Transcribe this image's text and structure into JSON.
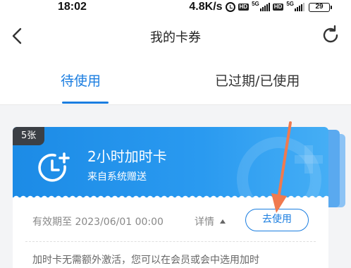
{
  "status_bar": {
    "time": "18:02",
    "speed": "4.8K/s",
    "hd_badge": "HD",
    "network_1": "5G",
    "network_2": "5G",
    "battery": "29"
  },
  "header": {
    "title": "我的卡券",
    "back_icon": "chevron-left-icon",
    "refresh_icon": "refresh-icon"
  },
  "tabs": [
    {
      "label": "待使用",
      "active": true
    },
    {
      "label": "已过期/已使用",
      "active": false
    }
  ],
  "colors": {
    "accent": "#1a7de0",
    "card_blue": "#2a9af0",
    "badge_bg": "#3b3f45",
    "arrow": "#f07a4f"
  },
  "coupon": {
    "count_badge": "5张",
    "icon": "clock-plus-icon",
    "title": "2小时加时卡",
    "subtitle": "来自系统赠送",
    "expiry": "有效期至 2023/06/01 00:00",
    "details_label": "详情",
    "use_button": "去使用",
    "description": "加时卡无需额外激活，您可以在会员或会中选用加时"
  }
}
